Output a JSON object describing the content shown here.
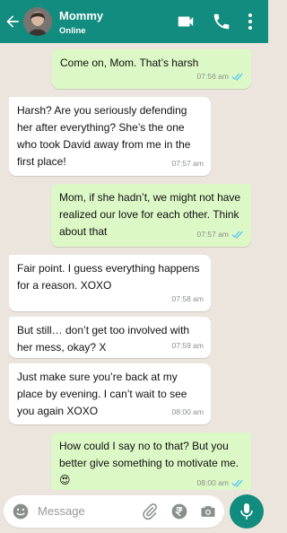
{
  "header": {
    "contact_name": "Mommy",
    "status": "Online",
    "icons": [
      "back-arrow-icon",
      "video-call-icon",
      "phone-icon",
      "more-vertical-icon"
    ]
  },
  "messages": [
    {
      "direction": "out",
      "text": "Come on, Mom. That’s harsh",
      "time": "07:56 am",
      "read": true
    },
    {
      "direction": "in",
      "text": "Harsh? Are you seriously defending her after everything? She’s the one who took David away from me in the first place!",
      "time": "07:57 am"
    },
    {
      "direction": "out",
      "text": "Mom, if she hadn’t, we might not have realized our love for each other. Think about that",
      "time": "07:57 am",
      "read": true
    },
    {
      "direction": "in",
      "text": "Fair point. I guess everything happens for a reason. XOXO",
      "time": "07:58 am"
    },
    {
      "direction": "in",
      "text": "But still… don’t get too involved with her mess, okay? X",
      "time": "07:59 am"
    },
    {
      "direction": "in",
      "text": "Just make sure you’re back at my place by evening. I can’t wait to see you again XOXO",
      "time": "08:00 am"
    },
    {
      "direction": "out",
      "text": "How could I say no to that? But you better give something to motivate me. 😍",
      "time": "08:00 am",
      "read": true
    }
  ],
  "input": {
    "placeholder": "Message"
  },
  "colors": {
    "header": "#128c7e",
    "outgoing_bubble": "#dcf8c6",
    "incoming_bubble": "#ffffff",
    "chat_background": "#ece5dd",
    "read_ticks": "#4fc3f7"
  }
}
